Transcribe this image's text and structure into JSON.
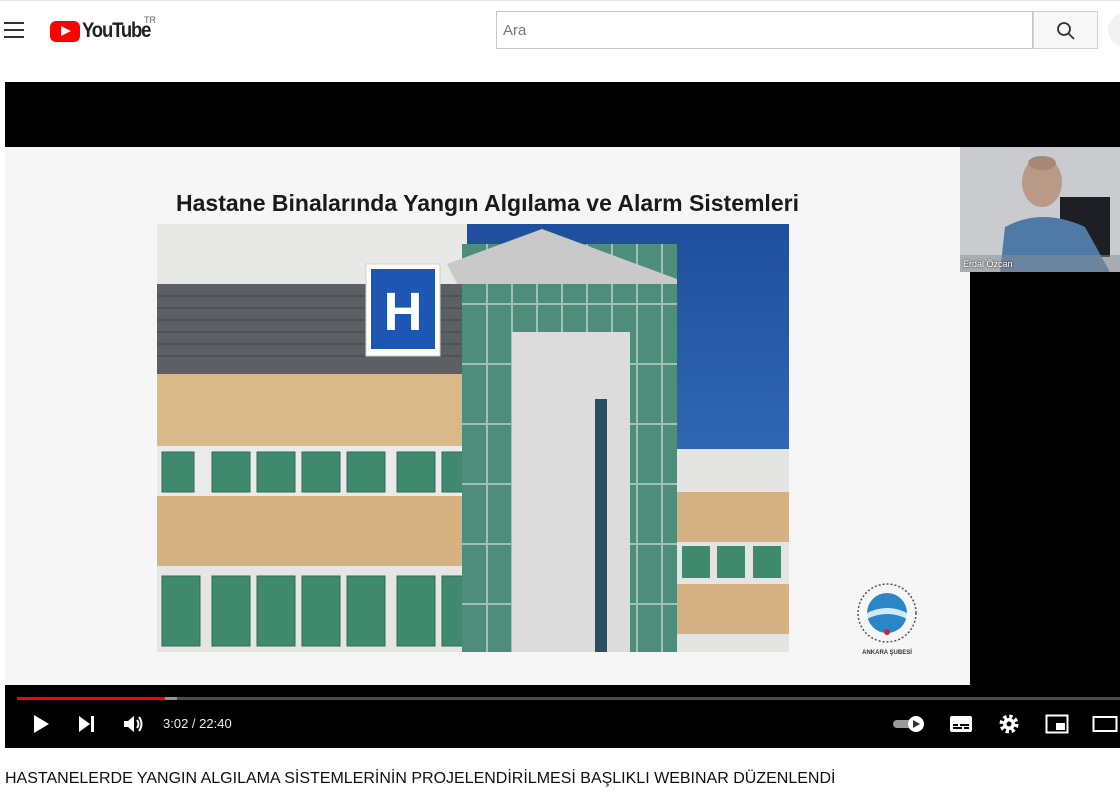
{
  "header": {
    "logo_text": "YouTube",
    "country_code": "TR",
    "search_placeholder": "Ara"
  },
  "video": {
    "slide_title": "Hastane Binalarında Yangın Algılama ve Alarm Sistemleri",
    "hospital_sign": "H",
    "webcam_name": "Erdal Özcan",
    "emblem_caption": "ANKARA ŞUBESİ",
    "current_time": "3:02",
    "duration": "22:40",
    "time_display": "3:02 / 22:40",
    "progress_fraction": 0.134,
    "buffered_fraction": 0.145
  },
  "title": "HASTANELERDE YANGIN ALGILAMA SİSTEMLERİNİN PROJELENDİRİLMESİ BAŞLIKLI WEBINAR DÜZENLENDİ",
  "colors": {
    "brand_red": "#ff0000",
    "sky": "#2c5fa8",
    "sign_blue": "#1e56b3"
  }
}
